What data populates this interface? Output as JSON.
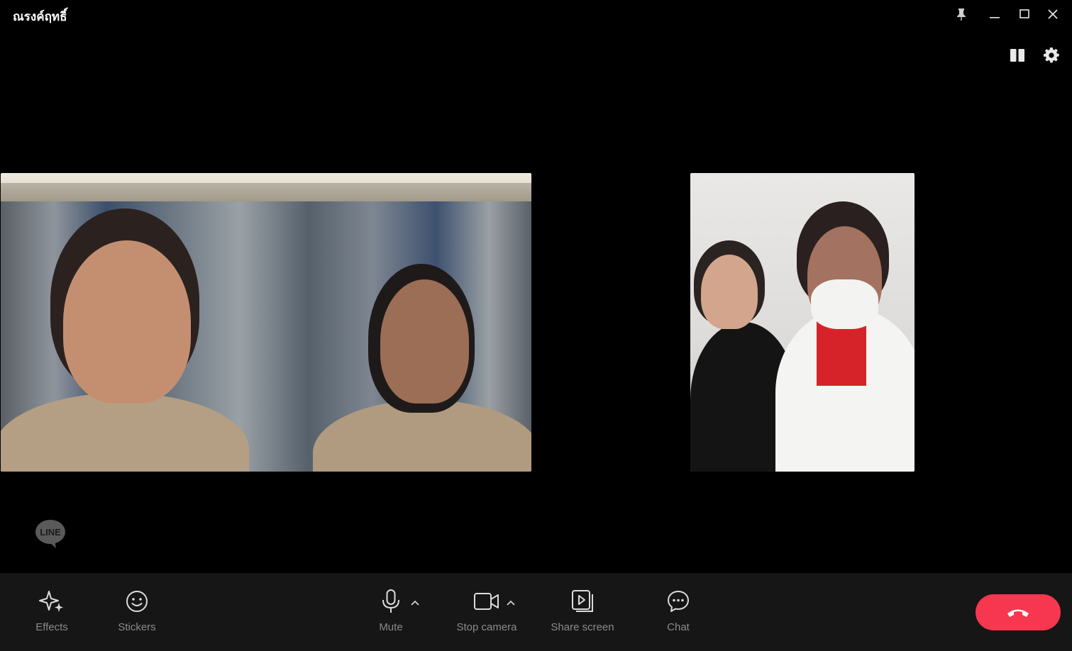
{
  "window": {
    "title": "ณรงค์ฤทธิ์"
  },
  "colors": {
    "background": "#000000",
    "toolbar": "#161616",
    "end_call": "#f7374f",
    "label": "#8b8b8b"
  },
  "icons": {
    "pin": "pin-icon",
    "minimize": "minimize-icon",
    "maximize": "maximize-icon",
    "close": "close-icon",
    "layout": "layout-icon",
    "settings": "gear-icon",
    "logo": "line-logo-icon"
  },
  "logo": {
    "text": "LINE"
  },
  "toolbar": {
    "effects": "Effects",
    "stickers": "Stickers",
    "mute": "Mute",
    "stop_camera": "Stop camera",
    "share_screen": "Share screen",
    "chat": "Chat"
  }
}
